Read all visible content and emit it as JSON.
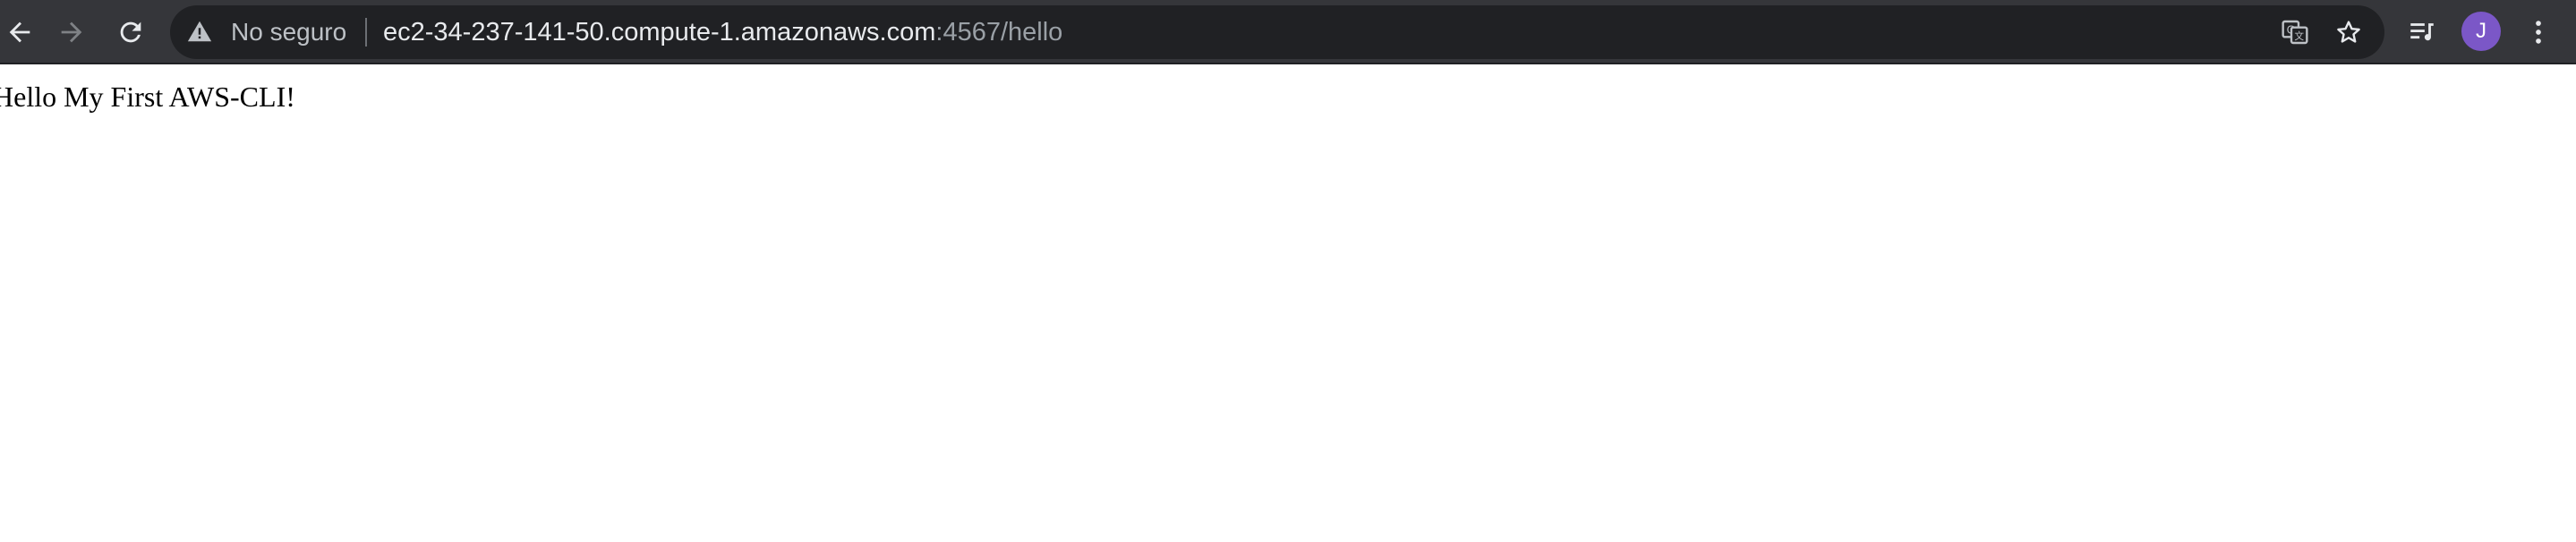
{
  "browser": {
    "security_label": "No seguro",
    "url_host": "ec2-34-237-141-50.compute-1.amazonaws.com",
    "url_path": ":4567/hello",
    "profile_initial": "J",
    "icons": [
      "back-arrow-icon",
      "forward-arrow-icon",
      "reload-icon",
      "warning-triangle-icon",
      "translate-icon",
      "star-icon",
      "media-queue-icon",
      "more-vertical-icon"
    ],
    "colors": {
      "toolbar": "#35363a",
      "omnibox": "#202124",
      "avatar": "#7b57c7"
    }
  },
  "page": {
    "body_text": "Hello My First AWS-CLI!"
  }
}
